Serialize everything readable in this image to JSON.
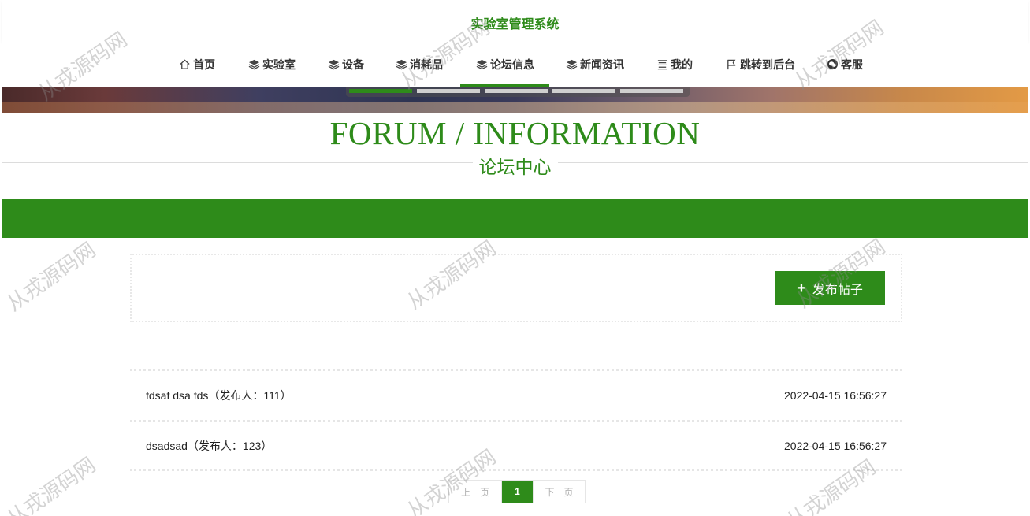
{
  "site": {
    "title": "实验室管理系统"
  },
  "nav": {
    "items": [
      {
        "label": "首页",
        "icon": "home-icon"
      },
      {
        "label": "实验室",
        "icon": "layers-icon"
      },
      {
        "label": "设备",
        "icon": "layers-icon"
      },
      {
        "label": "消耗品",
        "icon": "layers-icon"
      },
      {
        "label": "论坛信息",
        "icon": "layers-icon",
        "active": true
      },
      {
        "label": "新闻资讯",
        "icon": "layers-icon"
      },
      {
        "label": "我的",
        "icon": "list-icon"
      },
      {
        "label": "跳转到后台",
        "icon": "flag-icon"
      },
      {
        "label": "客服",
        "icon": "wechat-icon"
      }
    ]
  },
  "banner": {
    "slides": 5,
    "active_slide": 1
  },
  "section": {
    "title_en": "FORUM / INFORMATION",
    "title_cn": "论坛中心"
  },
  "actions": {
    "publish_label": "发布帖子"
  },
  "posts": [
    {
      "title": "fdsaf dsa fds（发布人：111）",
      "time": "2022-04-15 16:56:27"
    },
    {
      "title": "dsadsad（发布人：123）",
      "time": "2022-04-15 16:56:27"
    }
  ],
  "pagination": {
    "prev": "上一页",
    "current": "1",
    "next": "下一页"
  },
  "watermark": "从戎源码网",
  "colors": {
    "brand": "#2e8b1a"
  }
}
